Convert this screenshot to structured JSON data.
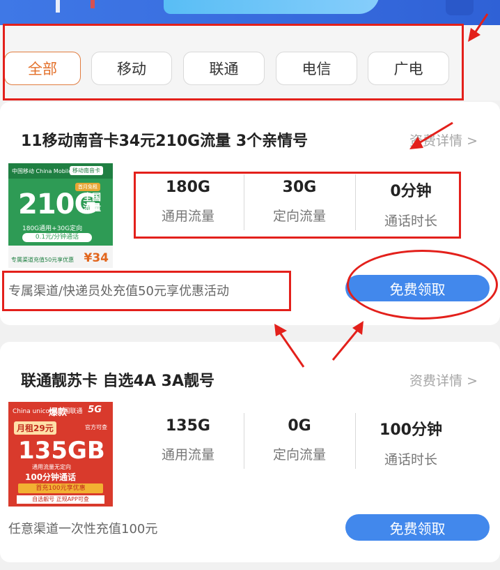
{
  "filters": {
    "tabs": [
      {
        "label": "全部",
        "active": true
      },
      {
        "label": "移动",
        "active": false
      },
      {
        "label": "联通",
        "active": false
      },
      {
        "label": "电信",
        "active": false
      },
      {
        "label": "广电",
        "active": false
      }
    ]
  },
  "cards": [
    {
      "title": "11移动南音卡34元210G流量 3个亲情号",
      "detail_link": "资费详情 >",
      "stats": [
        {
          "value": "180G",
          "label": "通用流量"
        },
        {
          "value": "30G",
          "label": "定向流量"
        },
        {
          "value": "0分钟",
          "label": "通话时长"
        }
      ],
      "promo": "专属渠道/快递员处充值50元享优惠活动",
      "button": "免费领取",
      "image": {
        "header": "中国移动 China Mobile",
        "header_tag": "移动南音卡",
        "tag": "首月免租",
        "big": "210G",
        "side_line1": "全国",
        "side_line2": "流量",
        "sub": "180G通用+30G定向",
        "pill": "0.1元/分钟通话",
        "foot": "专属渠道充值50元享优惠",
        "price": "¥34"
      }
    },
    {
      "title": "联通靓苏卡 自选4A 3A靓号",
      "detail_link": "资费详情 >",
      "stats": [
        {
          "value": "135G",
          "label": "通用流量"
        },
        {
          "value": "0G",
          "label": "定向流量"
        },
        {
          "value": "100分钟",
          "label": "通话时长"
        }
      ],
      "promo": "任意渠道一次性充值100元",
      "button": "免费领取",
      "image": {
        "logo": "China unicom 中国联通",
        "hot": "爆款",
        "g5": "5G",
        "rent": "月租29元",
        "rent2": "官方可查",
        "big": "135GB",
        "sub": "通用流量无定向",
        "min": "100分钟通话",
        "ribbon": "首充100元享优惠",
        "foot": "自选靓号 正规APP可查"
      }
    }
  ],
  "colors": {
    "accent": "#4288ec",
    "active_tab": "#e3702a",
    "annotation": "#e3201b"
  }
}
